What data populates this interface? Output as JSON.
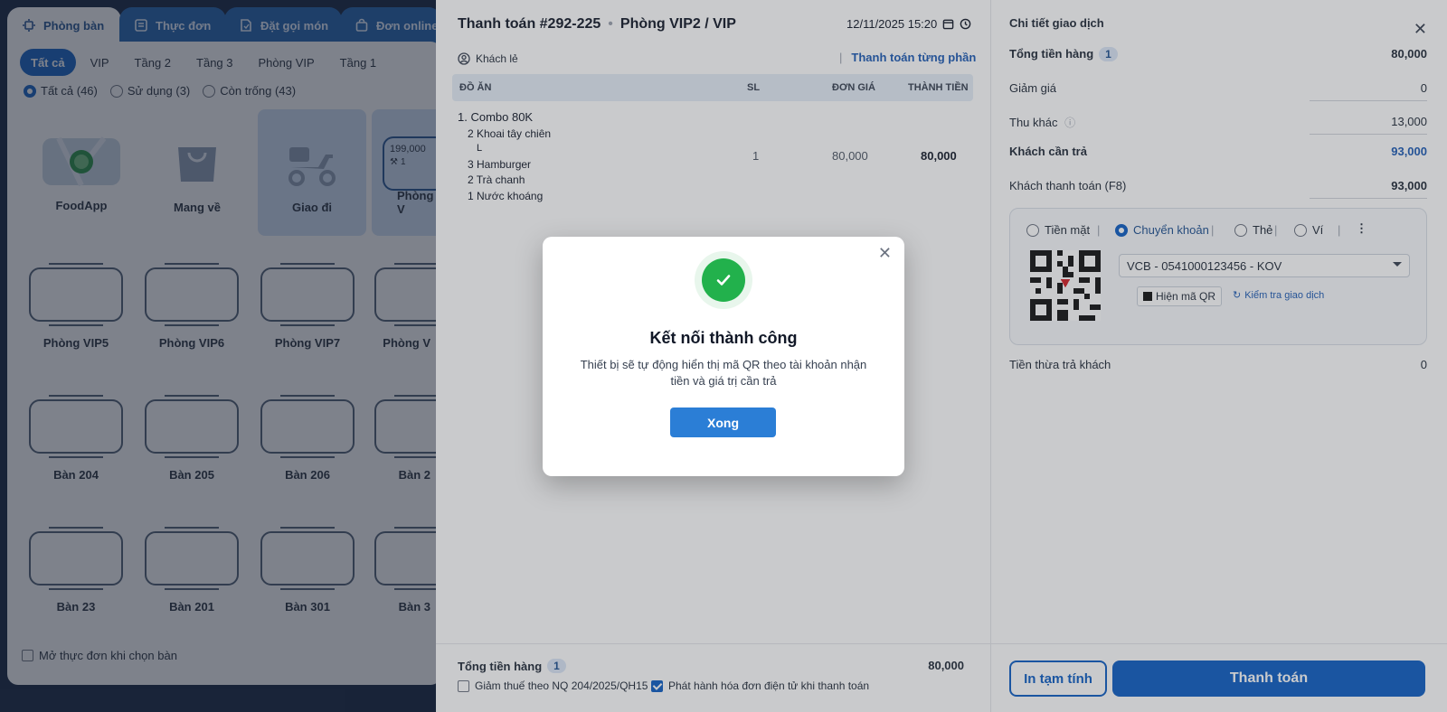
{
  "tabs": [
    {
      "label": "Phòng bàn",
      "icon": "table-icon"
    },
    {
      "label": "Thực đơn",
      "icon": "menu-icon"
    },
    {
      "label": "Đặt gọi món",
      "icon": "order-icon"
    },
    {
      "label": "Đơn online",
      "icon": "bag-icon"
    }
  ],
  "areas": [
    "Tất cả",
    "VIP",
    "Tầng 2",
    "Tầng 3",
    "Phòng VIP",
    "Tầng 1"
  ],
  "status_filters": [
    "Tất cả (46)",
    "Sử dụng (3)",
    "Còn trống (43)"
  ],
  "special_cards": [
    "FoodApp",
    "Mang về",
    "Giao đi"
  ],
  "selected_room": {
    "name": "Phòng V",
    "amount": "199,000",
    "guests": "1"
  },
  "tables_row1": [
    "Phòng VIP5",
    "Phòng VIP6",
    "Phòng VIP7",
    "Phòng V"
  ],
  "tables_row2": [
    "Bàn 204",
    "Bàn 205",
    "Bàn 206",
    "Bàn 2"
  ],
  "tables_row3": [
    "Bàn 23",
    "Bàn 201",
    "Bàn 301",
    "Bàn 3"
  ],
  "open_menu_label": "Mở thực đơn khi chọn bàn",
  "payment": {
    "title": "Thanh toán #292-225",
    "room": "Phòng VIP2 / VIP",
    "date": "12/11/2025 15:20",
    "customer": "Khách lẻ",
    "partial_label": "Thanh toán từng phần",
    "columns": {
      "item": "ĐỒ ĂN",
      "qty": "SL",
      "price": "ĐƠN GIÁ",
      "total": "THÀNH TIỀN"
    },
    "item": {
      "name": "1. Combo 80K",
      "qty": "1",
      "price": "80,000",
      "total": "80,000"
    },
    "sub_items": [
      "2 Khoai tây chiên",
      "L",
      "3 Hamburger",
      "2 Trà chanh",
      "1 Nước khoáng"
    ],
    "total_label": "Tổng tiền hàng",
    "total_count": "1",
    "total_value": "80,000",
    "tax_label": "Giảm thuế theo NQ 204/2025/QH15",
    "einvoice_label": "Phát hành hóa đơn điện tử khi thanh toán"
  },
  "details": {
    "title": "Chi tiết giao dịch",
    "total_label": "Tổng tiền hàng",
    "total_count": "1",
    "total_value": "80,000",
    "discount_label": "Giảm giá",
    "discount_value": "0",
    "other_label": "Thu khác",
    "other_value": "13,000",
    "due_label": "Khách cần trả",
    "due_value": "93,000",
    "paid_label": "Khách thanh toán (F8)",
    "paid_value": "93,000",
    "methods": [
      "Tiền mặt",
      "Chuyển khoản",
      "Thẻ",
      "Ví"
    ],
    "bank": "VCB - 0541000123456 - KOV",
    "show_qr": "Hiện mã QR",
    "check_tx": "Kiểm tra giao dịch",
    "change_label": "Tiền thừa trả khách",
    "change_value": "0",
    "print_btn": "In tạm tính",
    "pay_btn": "Thanh toán"
  },
  "dialog": {
    "title": "Kết nối thành công",
    "message": "Thiết bị sẽ tự động hiển thị mã QR theo tài khoản nhận tiền và giá trị cần trả",
    "button": "Xong"
  },
  "colors": {
    "primary": "#0d5ec4",
    "success": "#22b14c",
    "link": "#1d5bb5"
  }
}
